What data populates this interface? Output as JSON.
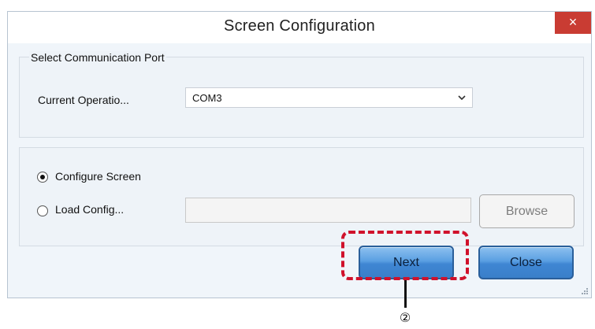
{
  "dialog": {
    "title": "Screen Configuration",
    "close_glyph": "×"
  },
  "port_group": {
    "title": "Select Communication Port",
    "current_operation_label": "Current Operatio...",
    "port_select": {
      "selected": "COM3"
    }
  },
  "mode_group": {
    "configure_screen": {
      "label": "Configure Screen",
      "selected": true
    },
    "load_config": {
      "label": "Load Config...",
      "selected": false
    },
    "config_path": {
      "value": ""
    },
    "browse_label": "Browse"
  },
  "buttons": {
    "next_label": "Next",
    "close_label": "Close"
  },
  "annotation": {
    "callout_number": "②",
    "highlight_color": "#d0112b"
  },
  "colors": {
    "close_x_bg": "#c93c33",
    "button_blue": "#4a90dc"
  },
  "icons": {
    "close": "close-icon",
    "dropdown": "chevron-down-icon",
    "resize": "resize-grip-icon"
  }
}
